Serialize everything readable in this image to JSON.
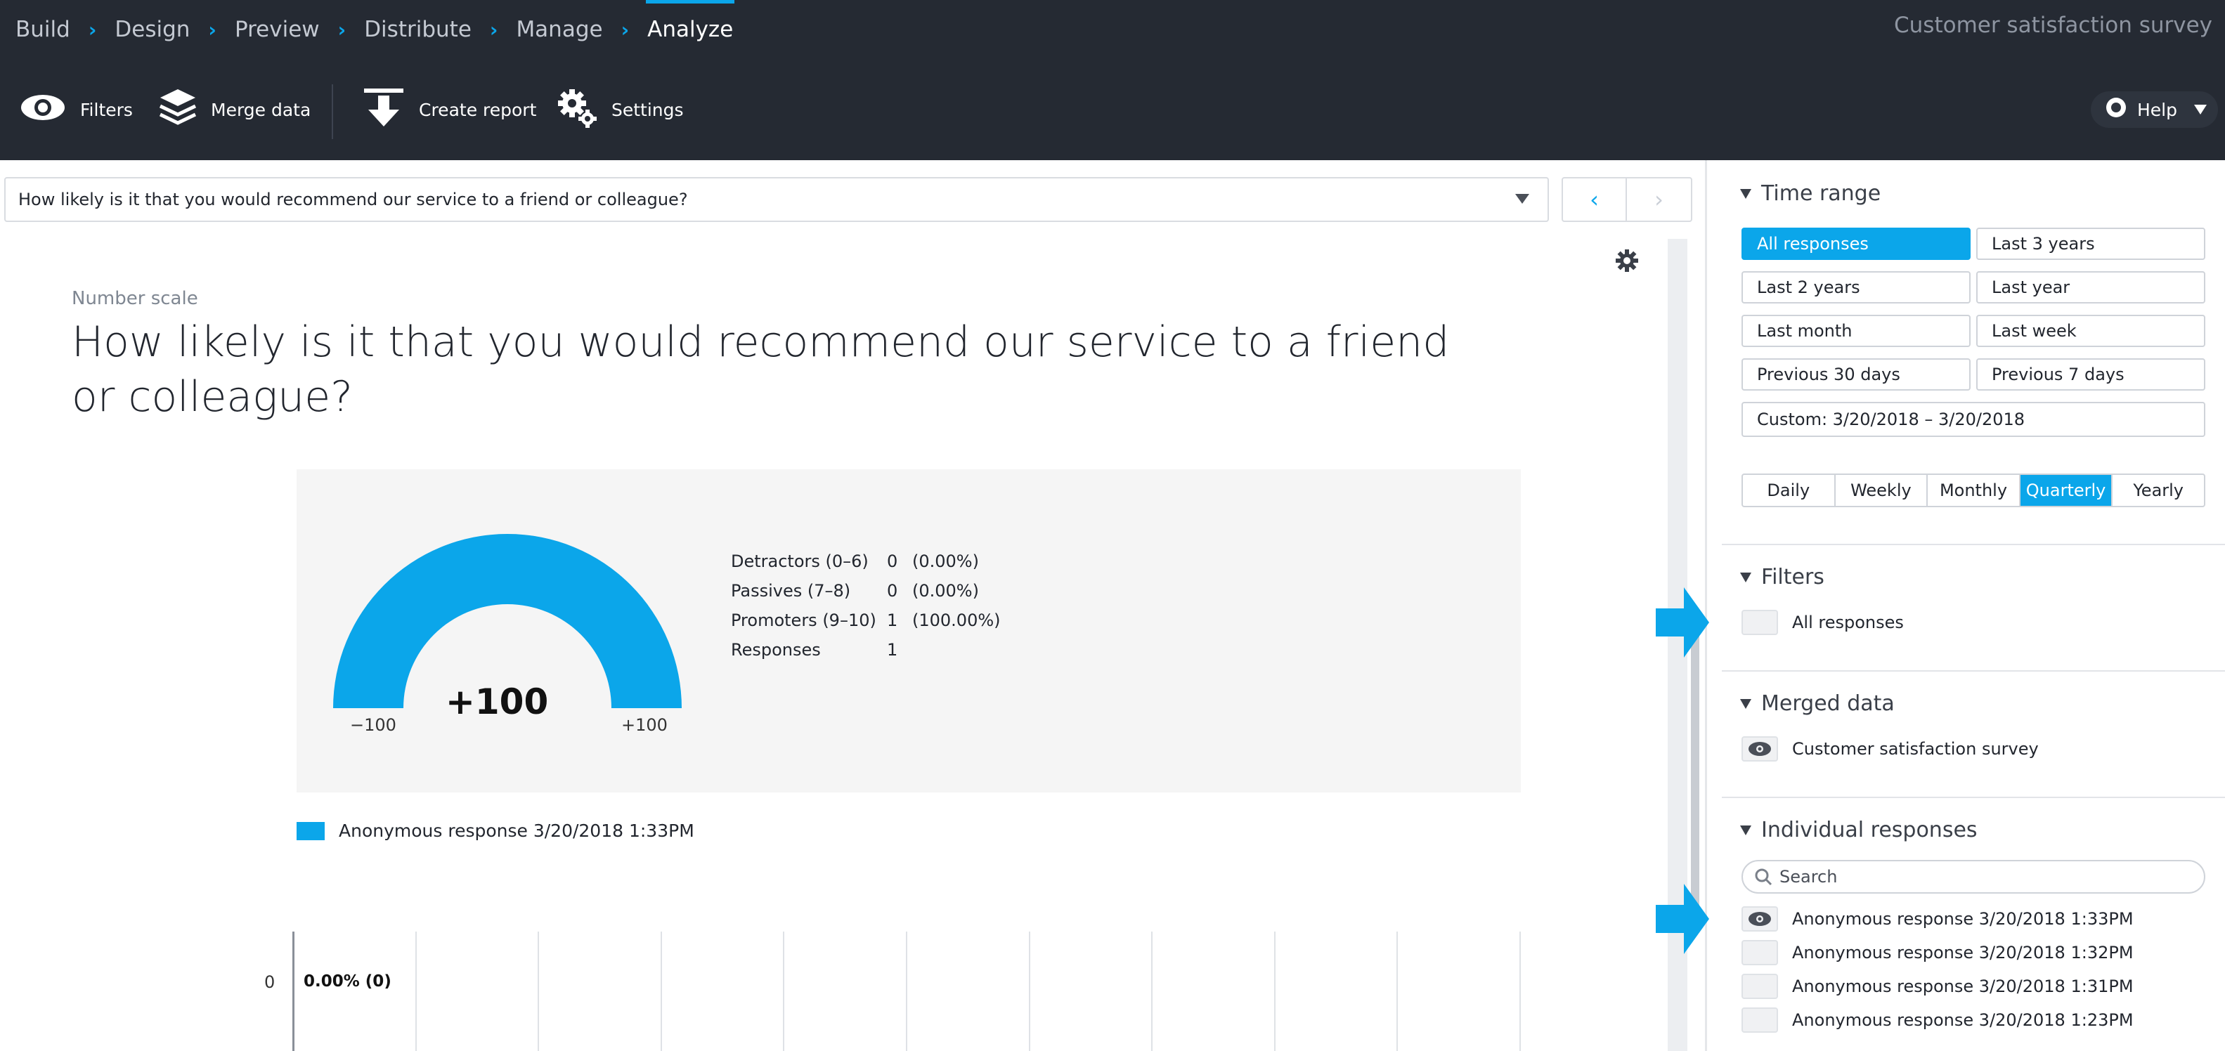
{
  "nav": {
    "crumbs": [
      "Build",
      "Design",
      "Preview",
      "Distribute",
      "Manage",
      "Analyze"
    ],
    "active": "Analyze",
    "survey_title": "Customer satisfaction survey"
  },
  "toolbar": {
    "filters_label": "Filters",
    "merge_label": "Merge data",
    "report_label": "Create report",
    "settings_label": "Settings",
    "help_label": "Help"
  },
  "question_select": {
    "value": "How likely is it that you would recommend our service to a friend or colleague?"
  },
  "question": {
    "type": "Number scale",
    "title": "How likely is it that you would recommend our service to a friend or colleague?"
  },
  "nps": {
    "score": "+100",
    "min_label": "−100",
    "max_label": "+100",
    "gauge_fraction": 1.0,
    "color": "#0ba6ea",
    "stats": [
      {
        "label": "Detractors (0–6)",
        "count": "0",
        "pct": "(0.00%)"
      },
      {
        "label": "Passives (7–8)",
        "count": "0",
        "pct": "(0.00%)"
      },
      {
        "label": "Promoters (9–10)",
        "count": "1",
        "pct": "(100.00%)"
      },
      {
        "label": "Responses",
        "count": "1",
        "pct": ""
      }
    ]
  },
  "legend": {
    "label": "Anonymous response 3/20/2018 1:33PM"
  },
  "grid": {
    "row_label": "0",
    "value_label": "0.00% (0)"
  },
  "panel": {
    "time_range": {
      "title": "Time range",
      "buttons": [
        "All responses",
        "Last 3 years",
        "Last 2 years",
        "Last year",
        "Last month",
        "Last week",
        "Previous 30 days",
        "Previous 7 days"
      ],
      "selected": "All responses",
      "custom": "Custom: 3/20/2018 – 3/20/2018",
      "periods": [
        "Daily",
        "Weekly",
        "Monthly",
        "Quarterly",
        "Yearly"
      ],
      "selected_period": "Quarterly"
    },
    "filters": {
      "title": "Filters",
      "item": "All responses"
    },
    "merged": {
      "title": "Merged data",
      "item": "Customer satisfaction survey"
    },
    "individual": {
      "title": "Individual responses",
      "search_placeholder": "Search",
      "items": [
        "Anonymous response 3/20/2018 1:33PM",
        "Anonymous response 3/20/2018 1:32PM",
        "Anonymous response 3/20/2018 1:31PM",
        "Anonymous response 3/20/2018 1:23PM"
      ]
    }
  },
  "colors": {
    "accent": "#0ba6ea",
    "nav_bg": "#252a33"
  }
}
